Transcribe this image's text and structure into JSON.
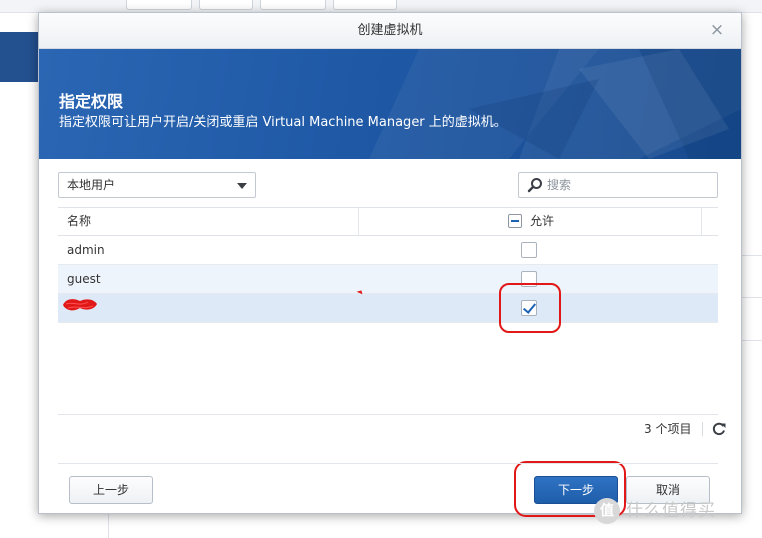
{
  "dialog": {
    "title": "创建虚拟机",
    "close_label": "×"
  },
  "banner": {
    "title": "指定权限",
    "description": "指定权限可让用户开启/关闭或重启 Virtual Machine Manager 上的虚拟机。"
  },
  "filter": {
    "selected": "本地用户",
    "search_placeholder": "搜索"
  },
  "table": {
    "columns": {
      "name": "名称",
      "allow": "允许"
    },
    "rows": [
      {
        "name": "admin",
        "allowed": false
      },
      {
        "name": "guest",
        "allowed": false
      },
      {
        "name": "",
        "allowed": true
      }
    ]
  },
  "footer": {
    "count": "3 个项目"
  },
  "buttons": {
    "prev": "上一步",
    "next": "下一步",
    "cancel": "取消"
  },
  "watermark": {
    "logo": "值",
    "text": "什么值得买"
  },
  "colors": {
    "accent": "#1f5ea9",
    "banner": "#2262b0",
    "annotation": "#e01818"
  }
}
